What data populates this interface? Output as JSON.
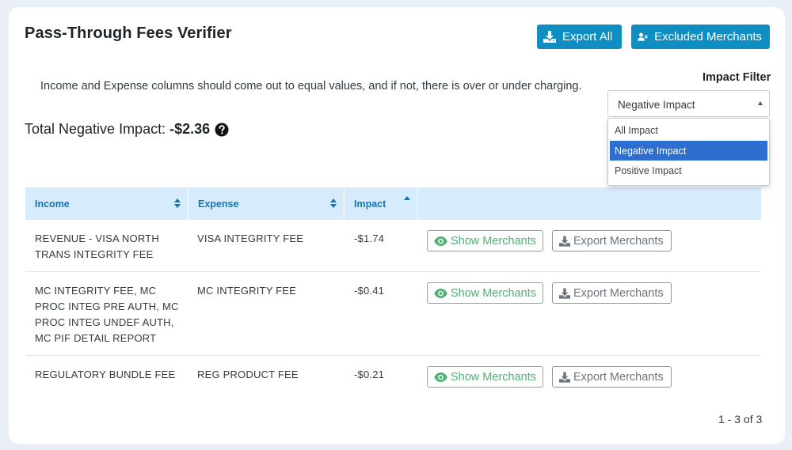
{
  "header": {
    "title": "Pass-Through Fees Verifier",
    "export_all_label": "Export All",
    "excluded_merchants_label": "Excluded Merchants"
  },
  "description": "Income and Expense columns should come out to equal values, and if not, there is over or under charging.",
  "filter": {
    "label": "Impact Filter",
    "selected": "Negative Impact",
    "options": [
      "All Impact",
      "Negative Impact",
      "Positive Impact"
    ]
  },
  "summary": {
    "label": "Total Negative Impact:",
    "value": "-$2.36"
  },
  "table": {
    "columns": [
      "Income",
      "Expense",
      "Impact"
    ],
    "rows": [
      {
        "income": "REVENUE - VISA NORTH TRANS INTEGRITY FEE",
        "expense": "VISA INTEGRITY FEE",
        "impact": "-$1.74",
        "show_label": "Show Merchants",
        "export_label": "Export Merchants"
      },
      {
        "income": "MC INTEGRITY FEE, MC PROC INTEG PRE AUTH, MC PROC INTEG UNDEF AUTH, MC PIF DETAIL REPORT",
        "expense": "MC INTEGRITY FEE",
        "impact": "-$0.41",
        "show_label": "Show Merchants",
        "export_label": "Export Merchants"
      },
      {
        "income": "REGULATORY BUNDLE FEE",
        "expense": "REG PRODUCT FEE",
        "impact": "-$0.21",
        "show_label": "Show Merchants",
        "export_label": "Export Merchants"
      }
    ]
  },
  "pagination": "1 - 3 of 3",
  "icons": {
    "export_all": "download-icon",
    "excluded": "user-x-icon",
    "help": "question-circle-icon",
    "show": "eye-icon",
    "export_row": "download-icon"
  },
  "colors": {
    "primary": "#0f8fc1",
    "header_bg": "#d6ebfb",
    "header_text": "#1476b4",
    "success": "#4db274",
    "secondary": "#6c757d",
    "selected_option": "#2d6ed0"
  }
}
